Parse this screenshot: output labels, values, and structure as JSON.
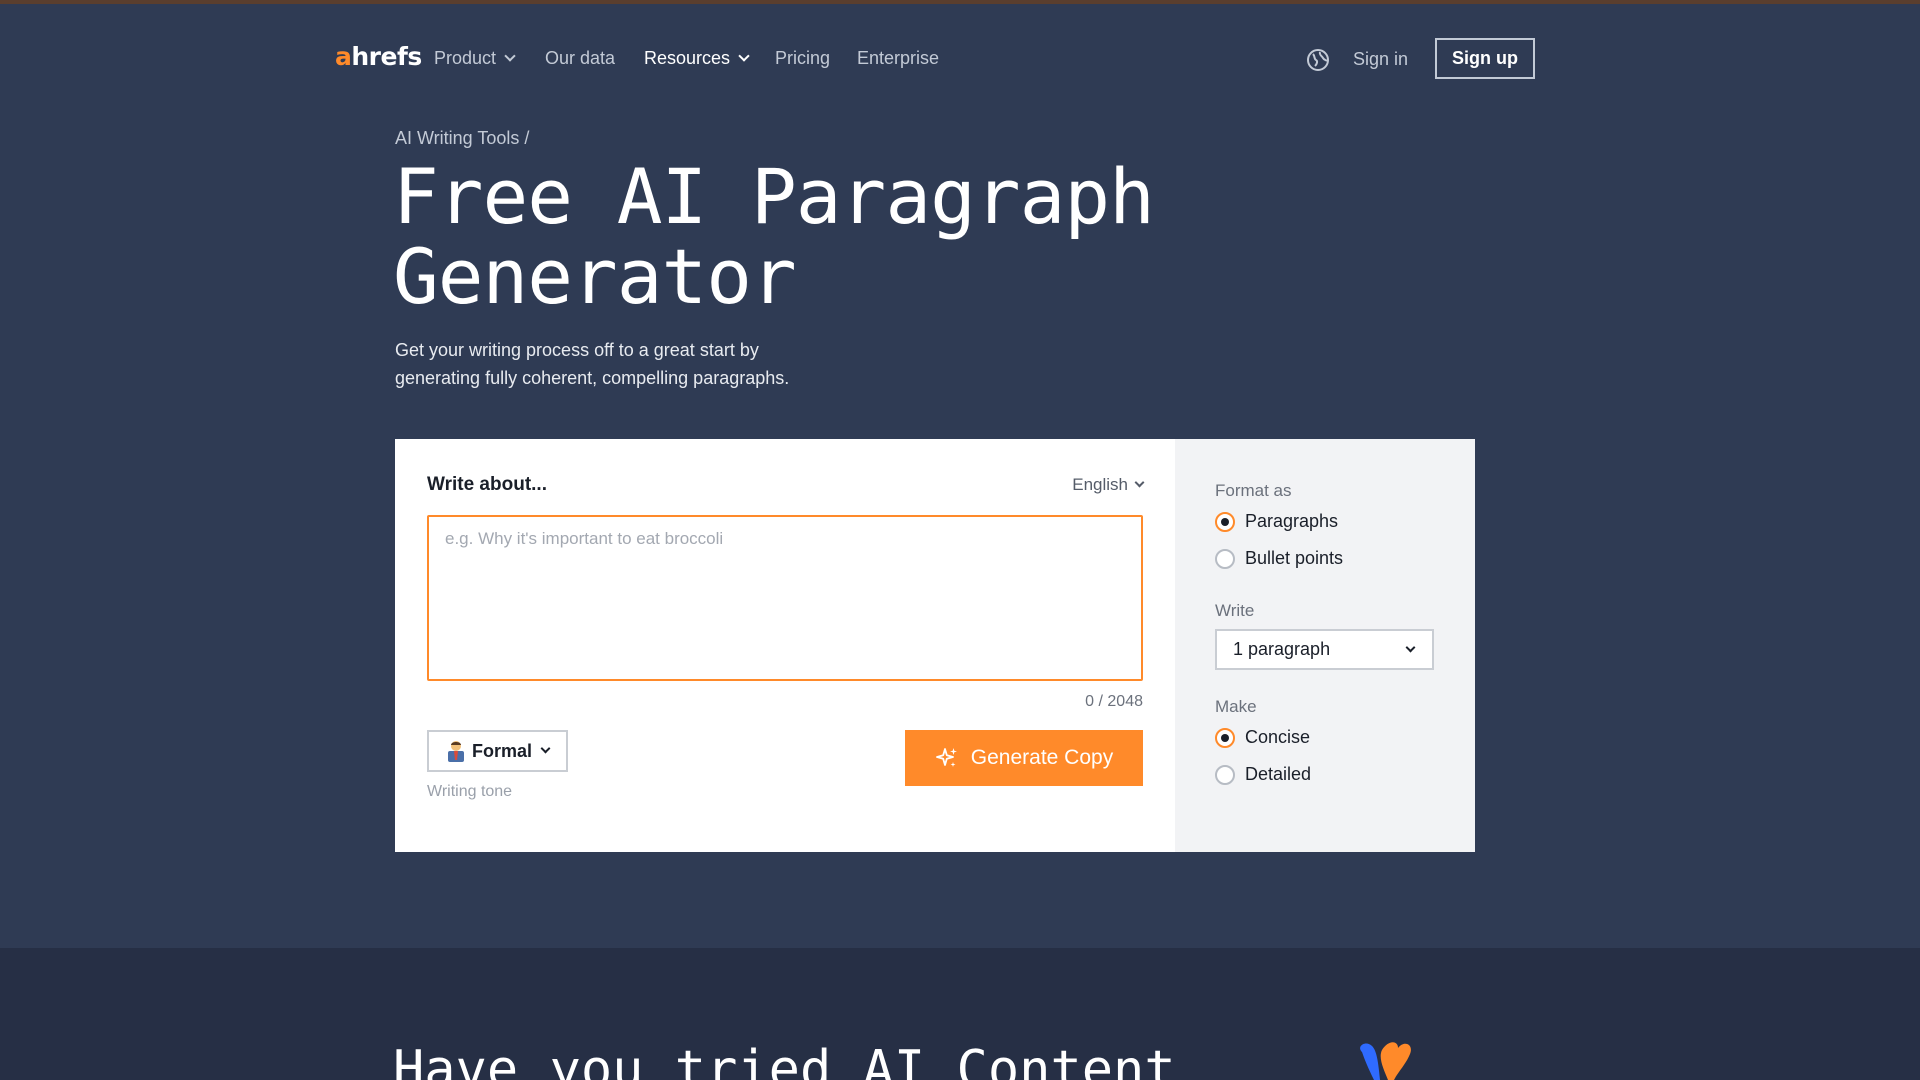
{
  "nav": {
    "logo_a": "a",
    "logo_rest": "hrefs",
    "links": [
      {
        "label": "Product",
        "dropdown": true
      },
      {
        "label": "Our data",
        "dropdown": false
      },
      {
        "label": "Resources",
        "dropdown": true
      },
      {
        "label": "Pricing",
        "dropdown": false
      },
      {
        "label": "Enterprise",
        "dropdown": false
      }
    ],
    "globe_icon": "globe-icon",
    "sign_in": "Sign in",
    "sign_up": "Sign up"
  },
  "hero": {
    "breadcrumb": "AI Writing Tools /",
    "title_line1": "Free AI Paragraph",
    "title_line2": "Generator",
    "subtitle_line1": "Get your writing process off to a great start by",
    "subtitle_line2": "generating fully coherent, compelling paragraphs."
  },
  "tool": {
    "write_label": "Write about...",
    "language": "English",
    "input_placeholder": "e.g. Why it's important to eat broccoli",
    "input_value": "",
    "counter": "0 / 2048",
    "tone": "Formal",
    "tone_icon": "business-person-icon",
    "tone_label": "Writing tone",
    "generate_label": "Generate Copy",
    "generate_icon": "sparkles-icon"
  },
  "options": {
    "format_label": "Format as",
    "format_options": [
      {
        "label": "Paragraphs",
        "selected": true
      },
      {
        "label": "Bullet points",
        "selected": false
      }
    ],
    "write_label": "Write",
    "write_value": "1 paragraph",
    "make_label": "Make",
    "make_options": [
      {
        "label": "Concise",
        "selected": true
      },
      {
        "label": "Detailed",
        "selected": false
      }
    ]
  },
  "lower": {
    "title": "Have you tried AI Content"
  },
  "colors": {
    "background": "#2f3b54",
    "accent": "#ff8a2a",
    "lower_background": "#262f45"
  }
}
